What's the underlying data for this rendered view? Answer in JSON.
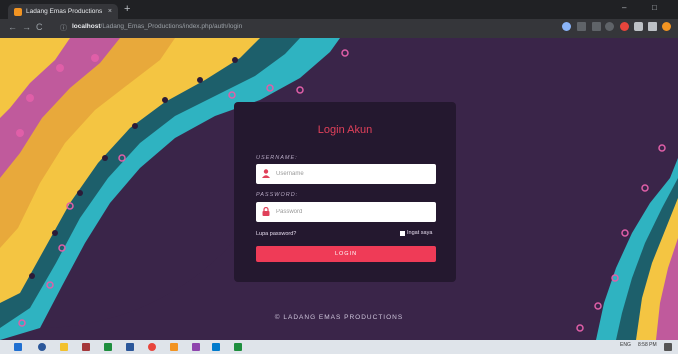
{
  "browser": {
    "tab_title": "Ladang Emas Productions",
    "tab_close": "×",
    "new_tab": "+",
    "url_host": "localhost",
    "url_path": "/Ladang_Emas_Productions/index.php/auth/login",
    "nav": {
      "back": "←",
      "forward": "→",
      "reload": "C"
    },
    "window": {
      "minimize": "–",
      "maximize": "□"
    }
  },
  "login": {
    "title": "Login Akun",
    "username_label": "USERNAME:",
    "username_placeholder": "Username",
    "password_label": "PASSWORD:",
    "password_placeholder": "Password",
    "forgot_text": "Lupa password?",
    "remember_text": "Ingat saya",
    "submit_label": "LOGIN"
  },
  "footer": {
    "text": "© LADANG EMAS PRODUCTIONS"
  },
  "taskbar": {
    "time": "8:58 PM",
    "lang": "ENG"
  },
  "colors": {
    "page_bg": "#3a2549",
    "card_bg": "#24182f",
    "accent": "#ef3b57",
    "mandala_yellow": "#f4c542",
    "mandala_teal": "#2fb3c1"
  }
}
